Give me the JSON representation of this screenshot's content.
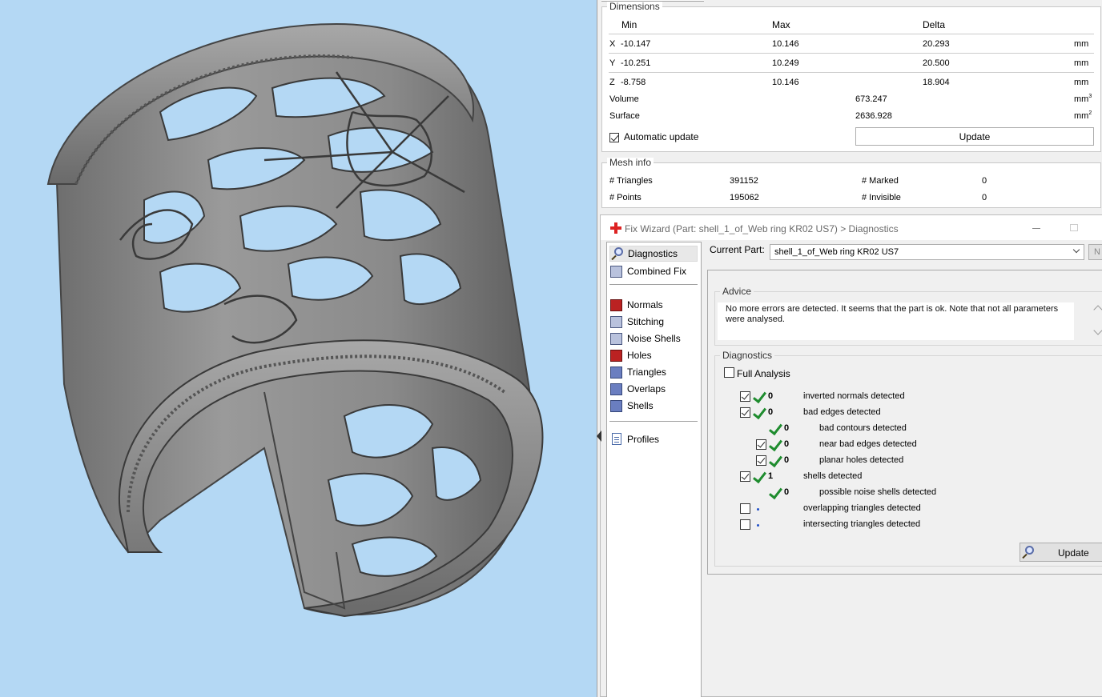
{
  "dimensions": {
    "title": "Dimensions",
    "col_min": "Min",
    "col_max": "Max",
    "col_delta": "Delta",
    "rows": [
      {
        "axis": "X",
        "min": "-10.147",
        "max": "10.146",
        "delta": "20.293",
        "unit": "mm"
      },
      {
        "axis": "Y",
        "min": "-10.251",
        "max": "10.249",
        "delta": "20.500",
        "unit": "mm"
      },
      {
        "axis": "Z",
        "min": "-8.758",
        "max": "10.146",
        "delta": "18.904",
        "unit": "mm"
      }
    ],
    "volume_label": "Volume",
    "volume_value": "673.247",
    "volume_unit": "mm",
    "volume_unit_exp": "3",
    "surface_label": "Surface",
    "surface_value": "2636.928",
    "surface_unit": "mm",
    "surface_unit_exp": "2",
    "auto_update_label": "Automatic update",
    "auto_update_checked": true,
    "update_label": "Update"
  },
  "mesh_info": {
    "title": "Mesh info",
    "triangles_label": "# Triangles",
    "triangles_value": "391152",
    "points_label": "# Points",
    "points_value": "195062",
    "marked_label": "# Marked",
    "marked_value": "0",
    "invisible_label": "# Invisible",
    "invisible_value": "0"
  },
  "wizard": {
    "title": "Fix Wizard (Part: shell_1_of_Web ring KR02 US7) > Diagnostics",
    "current_part_label": "Current Part:",
    "current_part_value": "shell_1_of_Web ring KR02 US7",
    "next_button_label": "N",
    "nav": {
      "diagnostics": "Diagnostics",
      "combined_fix": "Combined Fix",
      "normals": "Normals",
      "stitching": "Stitching",
      "noise_shells": "Noise Shells",
      "holes": "Holes",
      "triangles": "Triangles",
      "overlaps": "Overlaps",
      "shells": "Shells",
      "profiles": "Profiles"
    },
    "advice_title": "Advice",
    "advice_text": "No more errors are detected. It seems that the part is ok. Note that not all parameters were analysed.",
    "diagnostics_title": "Diagnostics",
    "full_analysis_label": "Full Analysis",
    "rows": [
      {
        "text": "inverted normals detected",
        "count": "0",
        "checked": true,
        "status": "ok"
      },
      {
        "text": "bad edges detected",
        "count": "0",
        "checked": true,
        "status": "ok"
      },
      {
        "text": "bad contours detected",
        "count": "0",
        "checked": null,
        "status": "ok"
      },
      {
        "text": "near bad edges detected",
        "count": "0",
        "checked": true,
        "status": "ok"
      },
      {
        "text": "planar holes detected",
        "count": "0",
        "checked": true,
        "status": "ok"
      },
      {
        "text": "shells detected",
        "count": "1",
        "checked": true,
        "status": "ok"
      },
      {
        "text": "possible noise shells detected",
        "count": "0",
        "checked": null,
        "status": "ok"
      },
      {
        "text": "overlapping triangles detected",
        "count": "",
        "checked": false,
        "status": "pending"
      },
      {
        "text": "intersecting triangles detected",
        "count": "",
        "checked": false,
        "status": "pending"
      }
    ],
    "update_label": "Update"
  },
  "colors": {
    "viewport_bg": "#b4d8f4",
    "model_gray": "#8a8a8a",
    "check_green": "#1e8c2e"
  }
}
